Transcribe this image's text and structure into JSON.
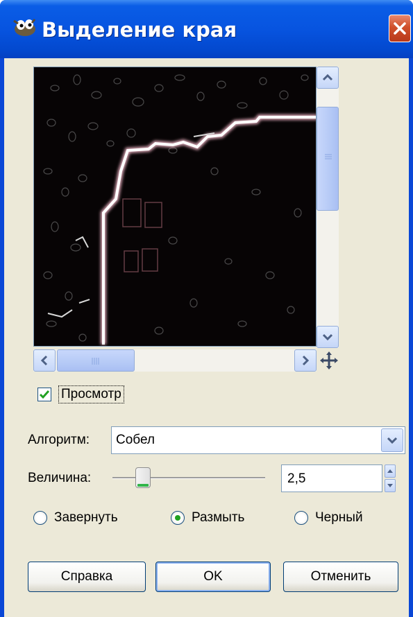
{
  "window": {
    "title": "Выделение края",
    "icon": "gimp-wilber-icon",
    "close_icon": "close-icon"
  },
  "preview": {
    "description_icon": "navigate-icon",
    "checkbox_label": "Просмотр",
    "checkbox_checked": true
  },
  "algorithm": {
    "label": "Алгоритм:",
    "value": "Собел"
  },
  "amount": {
    "label": "Величина:",
    "value": "2,5"
  },
  "edge_mode": {
    "options": [
      {
        "label": "Завернуть",
        "selected": false
      },
      {
        "label": "Размыть",
        "selected": true
      },
      {
        "label": "Черный",
        "selected": false
      }
    ]
  },
  "buttons": {
    "help": "Справка",
    "ok": "OK",
    "cancel": "Отменить"
  },
  "colors": {
    "titlebar": "#0754e0",
    "dialog_bg": "#ece9d8",
    "close_button": "#d0502b",
    "check_accent": "#21a121"
  }
}
